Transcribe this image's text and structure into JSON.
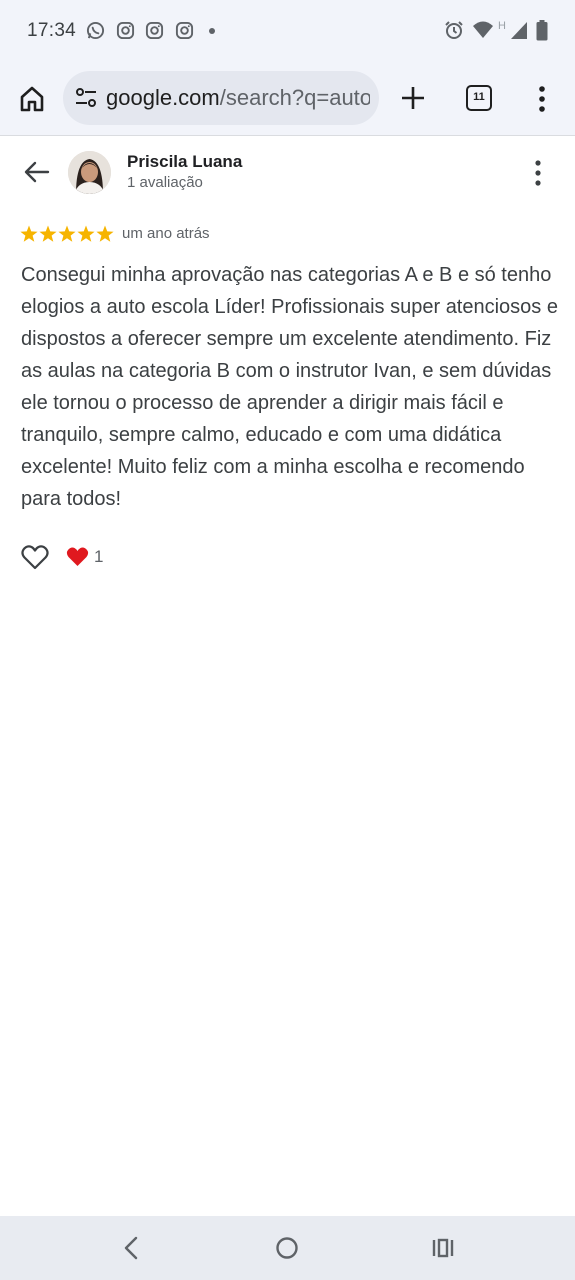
{
  "status_bar": {
    "time": "17:34",
    "left_icons": [
      "whatsapp-icon",
      "instagram-icon",
      "instagram-icon",
      "instagram-icon",
      "notification-dot"
    ],
    "right_icons": [
      "alarm-icon",
      "wifi-icon",
      "network-H-icon",
      "signal-icon",
      "battery-icon"
    ],
    "network_label": "H"
  },
  "browser": {
    "url_prefix": "google.com",
    "url_rest": "/search?q=auto",
    "tab_count": "11"
  },
  "review": {
    "reviewer_name": "Priscila Luana",
    "reviewer_meta": "1 avaliação",
    "rating": 5,
    "time": "um ano atrás",
    "text": "Consegui minha aprovação nas categorias A e B e só tenho elogios a auto escola Líder! Profissionais super atenciosos e dispostos a oferecer sempre um excelente atendimento. Fiz as aulas na categoria B com o instrutor Ivan, e sem dúvidas ele tornou o processo de aprender a dirigir mais fácil e tranquilo, sempre calmo, educado e com uma didática excelente! Muito feliz com a minha escolha e recomendo para todos!",
    "reaction_count": "1"
  },
  "colors": {
    "star": "#f6b400",
    "heart": "#e0191f",
    "toolbar_bg": "#f2f4fa",
    "navbar_bg": "#e8ebf1"
  }
}
